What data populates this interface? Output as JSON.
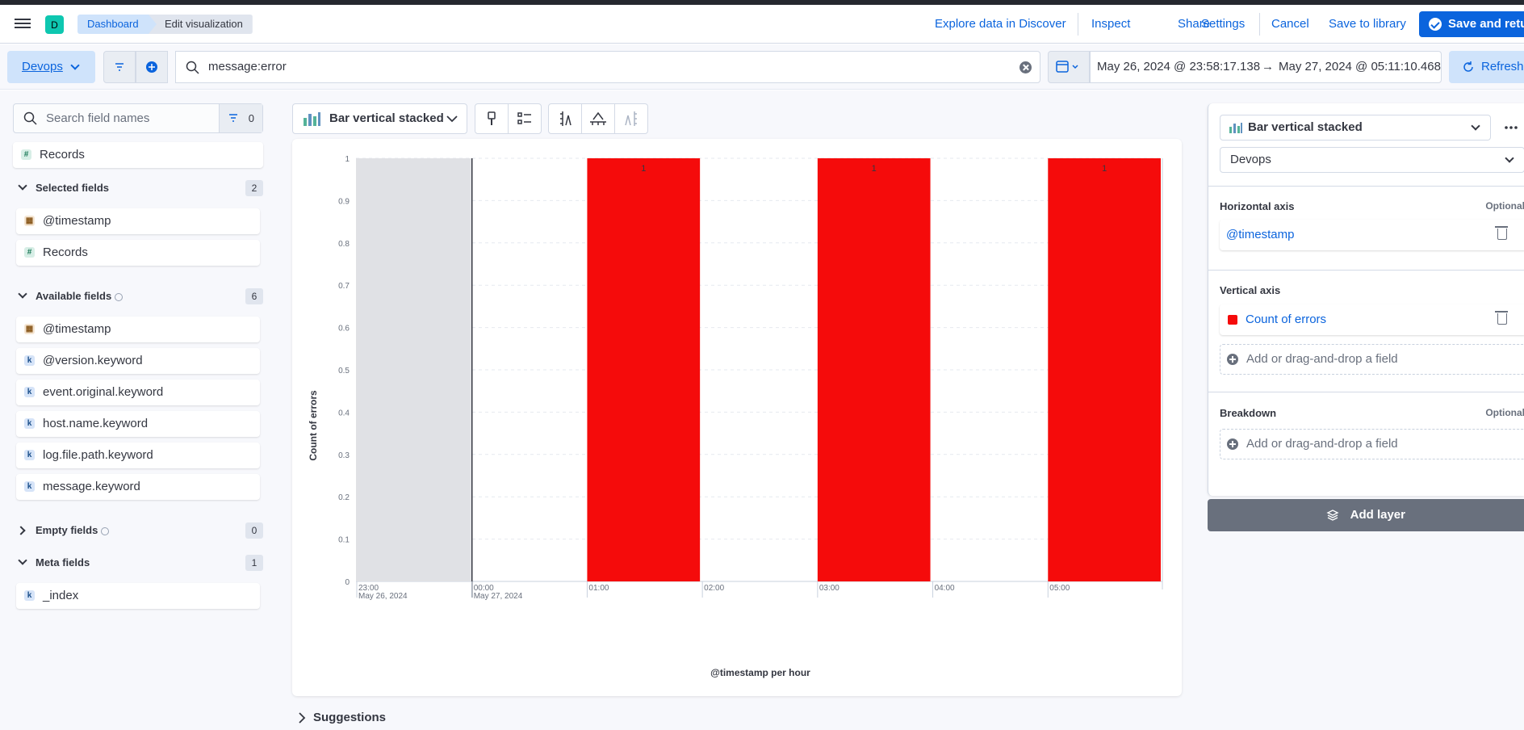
{
  "app": {
    "logo_letter": "D"
  },
  "breadcrumbs": [
    "Dashboard",
    "Edit visualization"
  ],
  "header_actions": {
    "explore": "Explore data in Discover",
    "inspect": "Inspect",
    "share": "Share",
    "settings": "Settings",
    "cancel": "Cancel",
    "save_library": "Save to library",
    "save_return": "Save and return"
  },
  "query": {
    "data_view": "Devops",
    "text": "message:error",
    "date_start": "May 26, 2024 @ 23:58:17.138",
    "arrow": "→",
    "date_end": "May 27, 2024 @ 05:11:10.468",
    "refresh": "Refresh"
  },
  "sidebar": {
    "search_placeholder": "Search field names",
    "filter_count": "0",
    "records_top": "Records",
    "selected": {
      "title": "Selected fields",
      "count": "2",
      "items": [
        {
          "name": "@timestamp",
          "type": "date"
        },
        {
          "name": "Records",
          "type": "number"
        }
      ]
    },
    "available": {
      "title": "Available fields",
      "count": "6",
      "items": [
        {
          "name": "@timestamp",
          "type": "date"
        },
        {
          "name": "@version.keyword",
          "type": "keyword"
        },
        {
          "name": "event.original.keyword",
          "type": "keyword"
        },
        {
          "name": "host.name.keyword",
          "type": "keyword"
        },
        {
          "name": "log.file.path.keyword",
          "type": "keyword"
        },
        {
          "name": "message.keyword",
          "type": "keyword"
        }
      ]
    },
    "empty": {
      "title": "Empty fields",
      "count": "0"
    },
    "meta": {
      "title": "Meta fields",
      "count": "1",
      "items": [
        {
          "name": "_index",
          "type": "keyword"
        }
      ]
    }
  },
  "toolbar": {
    "chart_type": "Bar vertical stacked"
  },
  "suggestions": "Suggestions",
  "config": {
    "chart_type": "Bar vertical stacked",
    "data_view": "Devops",
    "horizontal_axis": {
      "label": "Horizontal axis",
      "optional": "Optional",
      "field": "@timestamp"
    },
    "vertical_axis": {
      "label": "Vertical axis",
      "field": "Count of errors",
      "add": "Add or drag-and-drop a field"
    },
    "breakdown": {
      "label": "Breakdown",
      "optional": "Optional",
      "add": "Add or drag-and-drop a field"
    },
    "add_layer": "Add layer"
  },
  "colors": {
    "bar": "#f50b0b",
    "accent": "#0b64dd"
  },
  "chart_data": {
    "type": "bar",
    "stacked": true,
    "categories": [
      "23:00",
      "00:00",
      "01:00",
      "02:00",
      "03:00",
      "04:00",
      "05:00"
    ],
    "category_sublabels": [
      "May 26, 2024",
      "May 27, 2024",
      "",
      "",
      "",
      "",
      ""
    ],
    "values": [
      null,
      0,
      1,
      0,
      1,
      0,
      1
    ],
    "data_labels": [
      "",
      "",
      "1",
      "",
      "1",
      "",
      "1"
    ],
    "ylabel": "Count of errors",
    "xlabel": "@timestamp per hour",
    "ylim": [
      0,
      1
    ],
    "yticks": [
      "0",
      "0.1",
      "0.2",
      "0.3",
      "0.4",
      "0.5",
      "0.6",
      "0.7",
      "0.8",
      "0.9",
      "1"
    ],
    "grid": true,
    "legend": "none"
  }
}
